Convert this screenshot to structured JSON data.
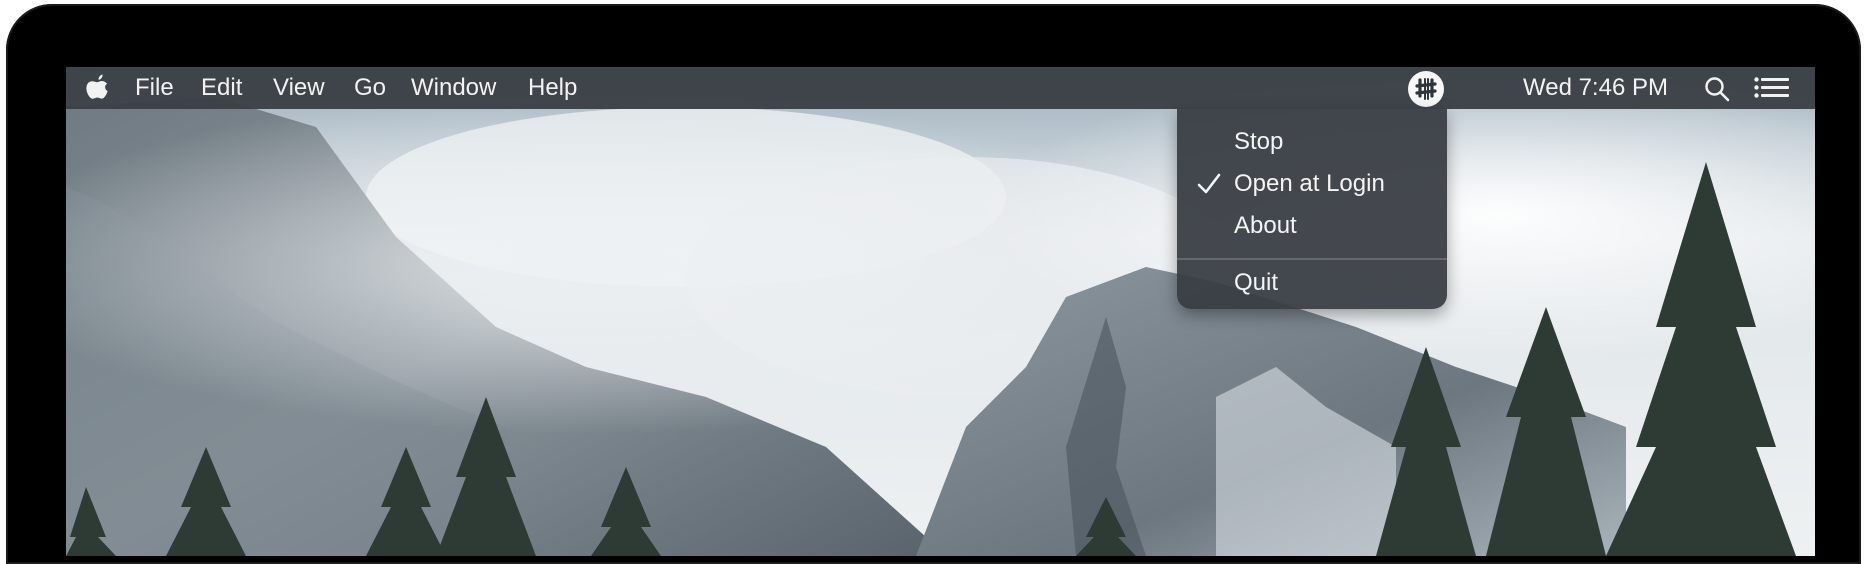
{
  "menubar": {
    "apple_icon": "apple-icon",
    "menus": [
      {
        "label": "File"
      },
      {
        "label": "Edit"
      },
      {
        "label": "View"
      },
      {
        "label": "Go"
      },
      {
        "label": "Window"
      },
      {
        "label": "Help"
      }
    ],
    "status": {
      "app_icon": "app-status-icon",
      "clock": "Wed 7:46 PM",
      "search_icon": "search-icon",
      "notification_icon": "notification-center-icon"
    }
  },
  "dropdown": {
    "items": [
      {
        "label": "Stop",
        "checked": false
      },
      {
        "label": "Open at Login",
        "checked": true
      },
      {
        "label": "About",
        "checked": false
      },
      {
        "label": "Quit",
        "checked": false
      }
    ]
  },
  "colors": {
    "menubar_bg": "#3a4045",
    "menu_text": "#f2f2f2",
    "dropdown_bg": "#383d43"
  }
}
